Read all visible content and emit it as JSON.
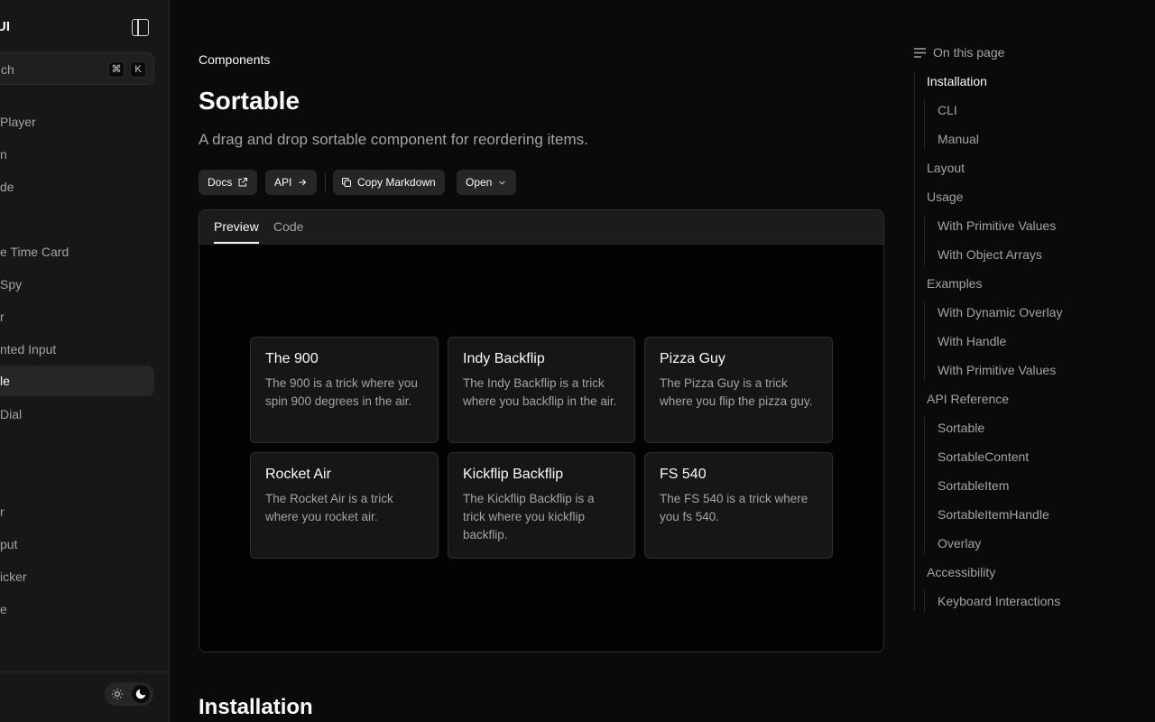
{
  "sidebar": {
    "brand": "UI",
    "search_placeholder": "ch",
    "search_kbd": [
      "⌘",
      "K"
    ],
    "items": [
      {
        "label": "Player"
      },
      {
        "label": "n"
      },
      {
        "label": "de"
      },
      {
        "label": "e Time Card"
      },
      {
        "label": "Spy"
      },
      {
        "label": "r"
      },
      {
        "label": "nted Input"
      },
      {
        "label": "le"
      },
      {
        "label": "Dial"
      },
      {
        "label": "r"
      },
      {
        "label": "put"
      },
      {
        "label": "icker"
      },
      {
        "label": "e"
      }
    ]
  },
  "page": {
    "breadcrumb": "Components",
    "title": "Sortable",
    "description": "A drag and drop sortable component for reordering items.",
    "buttons": {
      "docs": "Docs",
      "api": "API",
      "copy_markdown": "Copy Markdown",
      "open": "Open"
    },
    "tabs": [
      "Preview",
      "Code"
    ],
    "cards": [
      {
        "title": "The 900",
        "desc": "The 900 is a trick where you spin 900 degrees in the air."
      },
      {
        "title": "Indy Backflip",
        "desc": "The Indy Backflip is a trick where you backflip in the air."
      },
      {
        "title": "Pizza Guy",
        "desc": "The Pizza Guy is a trick where you flip the pizza guy."
      },
      {
        "title": "Rocket Air",
        "desc": "The Rocket Air is a trick where you rocket air."
      },
      {
        "title": "Kickflip Backflip",
        "desc": "The Kickflip Backflip is a trick where you kickflip backflip."
      },
      {
        "title": "FS 540",
        "desc": "The FS 540 is a trick where you fs 540."
      }
    ],
    "section_heading": "Installation"
  },
  "toc": {
    "heading": "On this page",
    "items": [
      {
        "label": "Installation"
      },
      {
        "label": "CLI"
      },
      {
        "label": "Manual"
      },
      {
        "label": "Layout"
      },
      {
        "label": "Usage"
      },
      {
        "label": "With Primitive Values"
      },
      {
        "label": "With Object Arrays"
      },
      {
        "label": "Examples"
      },
      {
        "label": "With Dynamic Overlay"
      },
      {
        "label": "With Handle"
      },
      {
        "label": "With Primitive Values"
      },
      {
        "label": "API Reference"
      },
      {
        "label": "Sortable"
      },
      {
        "label": "SortableContent"
      },
      {
        "label": "SortableItem"
      },
      {
        "label": "SortableItemHandle"
      },
      {
        "label": "Overlay"
      },
      {
        "label": "Accessibility"
      },
      {
        "label": "Keyboard Interactions"
      }
    ]
  },
  "colors": {
    "background": "#0a0a0a",
    "sidebar": "#171717",
    "text_primary": "#fafafa",
    "text_muted": "#a3a3a3"
  }
}
